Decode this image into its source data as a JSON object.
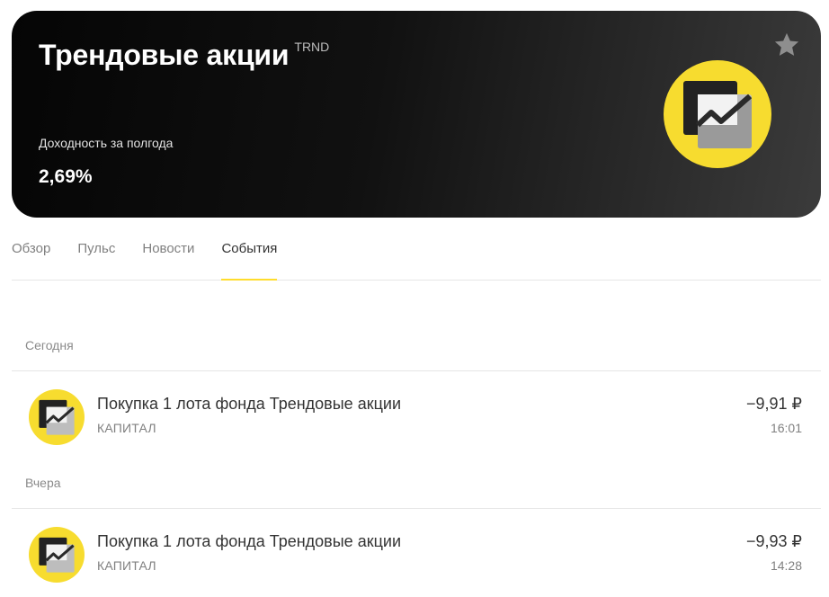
{
  "hero": {
    "title": "Трендовые акции",
    "ticker": "TRND",
    "yield_label": "Доходность за полгода",
    "yield_value": "2,69%",
    "colors": {
      "accent_yellow": "#ffdd2d",
      "card_dark": "#111111"
    },
    "icons": {
      "favorite": "star-icon",
      "fund_logo": "trend-chart-logo"
    }
  },
  "tabs": [
    {
      "label": "Обзор",
      "active": false
    },
    {
      "label": "Пульс",
      "active": false
    },
    {
      "label": "Новости",
      "active": false
    },
    {
      "label": "События",
      "active": true
    }
  ],
  "events": [
    {
      "day": "Сегодня",
      "items": [
        {
          "title": "Покупка 1 лота фонда Трендовые акции",
          "account": "КАПИТАЛ",
          "amount": "−9,91 ₽",
          "time": "16:01"
        }
      ]
    },
    {
      "day": "Вчера",
      "items": [
        {
          "title": "Покупка 1 лота фонда Трендовые акции",
          "account": "КАПИТАЛ",
          "amount": "−9,93 ₽",
          "time": "14:28"
        }
      ]
    }
  ]
}
